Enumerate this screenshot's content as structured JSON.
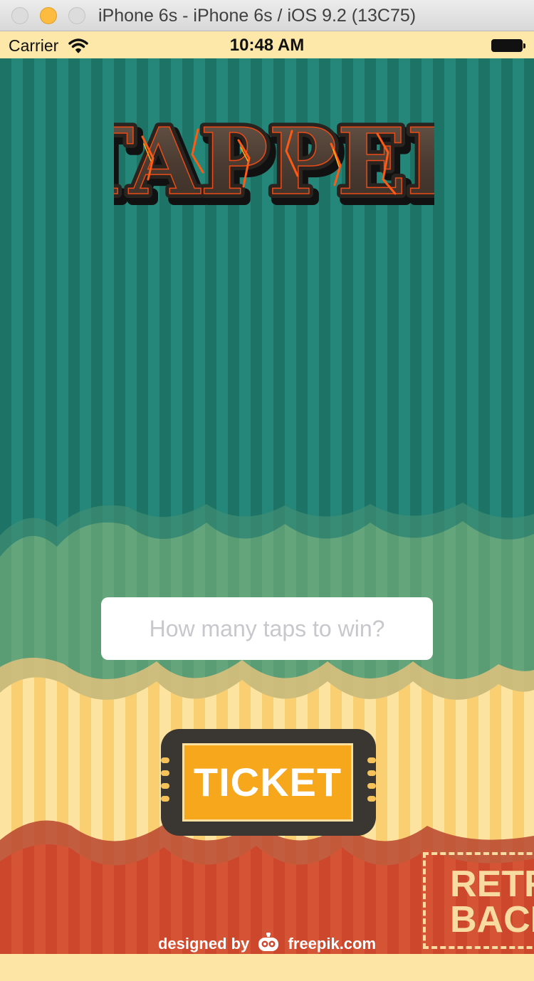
{
  "window": {
    "title": "iPhone 6s - iPhone 6s / iOS 9.2 (13C75)",
    "controls": [
      "close-icon",
      "minimize-icon",
      "maximize-icon"
    ]
  },
  "status_bar": {
    "carrier": "Carrier",
    "time": "10:48 AM",
    "icons": [
      "wifi-icon",
      "battery-icon"
    ]
  },
  "app": {
    "logo_text": "TAPPER",
    "taps_input": {
      "placeholder": "How many taps to win?",
      "value": ""
    },
    "ticket_button_label": "TICKET",
    "retro_badge_lines": "RETR\nBACK",
    "credit": {
      "prefix": "designed by",
      "brand": "freepik.com",
      "icon": "robot-logo-icon"
    }
  },
  "colors": {
    "teal": "#1f7d6c",
    "sage": "#5e9f77",
    "cream": "#fde5a6",
    "red": "#cf4a2f",
    "ticket_orange": "#f6a71c",
    "ticket_dark": "#3a3733"
  }
}
